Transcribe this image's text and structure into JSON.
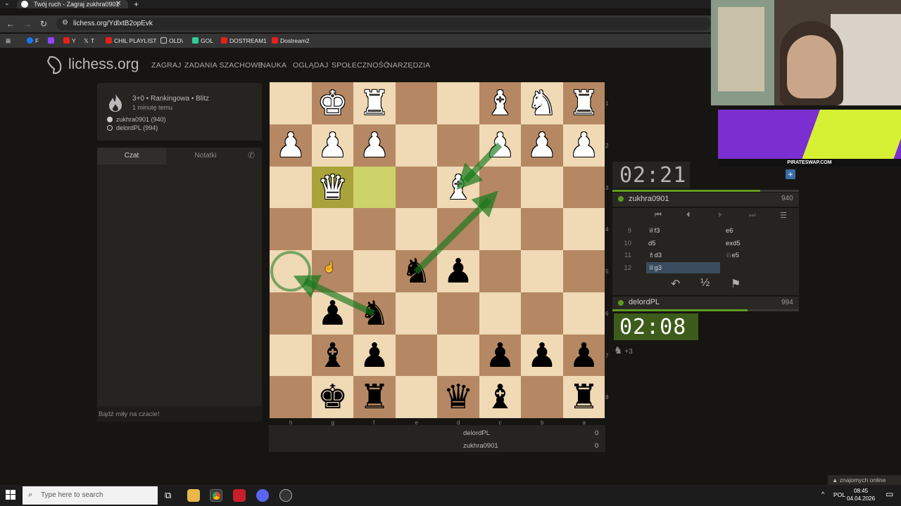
{
  "browser": {
    "tab_title": "Twój ruch - Zagraj zukhra0901",
    "url": "lichess.org/YdlxtB2opEvk",
    "bookmarks": [
      "F",
      "Y",
      "T",
      "CHIL PLAYLIST",
      "OLD\\",
      "GOL",
      "DOSTREAM1",
      "Dostream2"
    ]
  },
  "site": {
    "logo": "lichess.org",
    "nav": [
      "ZAGRAJ",
      "ZADANIA SZACHOWE",
      "NAUKA",
      "OGLĄDAJ",
      "SPOŁECZNOŚĆ",
      "NARZĘDZIA"
    ]
  },
  "game_info": {
    "type": "3+0 • Rankingowa • Blitz",
    "time": "1 minutę temu",
    "white_player": "zukhra0901 (940)",
    "black_player": "delordPL (994)"
  },
  "chat": {
    "tab_chat": "Czat",
    "tab_notes": "Notatki",
    "placeholder": "Bądź miły na czacie!"
  },
  "board": {
    "orientation": "black",
    "highlight_squares": [
      "f6",
      "g6"
    ],
    "ranks": [
      "1",
      "2",
      "3",
      "4",
      "5",
      "6",
      "7",
      "8"
    ],
    "files": [
      "h",
      "g",
      "f",
      "e",
      "d",
      "c",
      "b",
      "a"
    ]
  },
  "opponent": {
    "clock": "02:21",
    "name": "zukhra0901",
    "rating": "940"
  },
  "player": {
    "clock": "02:08",
    "name": "delordPL",
    "rating": "994",
    "material": "+3"
  },
  "moves": [
    {
      "no": "9",
      "white": "♕f3",
      "black": "e6"
    },
    {
      "no": "10",
      "white": "d5",
      "black": "exd5"
    },
    {
      "no": "11",
      "white": "♗d3",
      "black": "♘e5"
    },
    {
      "no": "12",
      "white": "♕g3",
      "black": ""
    }
  ],
  "score": [
    {
      "name": "delordPL",
      "value": "0"
    },
    {
      "name": "zukhra0901",
      "value": "0"
    }
  ],
  "overlay": {
    "ad_label": "PIRATESWAP.COM"
  },
  "taskbar": {
    "search_placeholder": "Type here to search",
    "lang": "POL",
    "time": "08:45",
    "date": "04.04.2026",
    "online": "znajomych online"
  }
}
